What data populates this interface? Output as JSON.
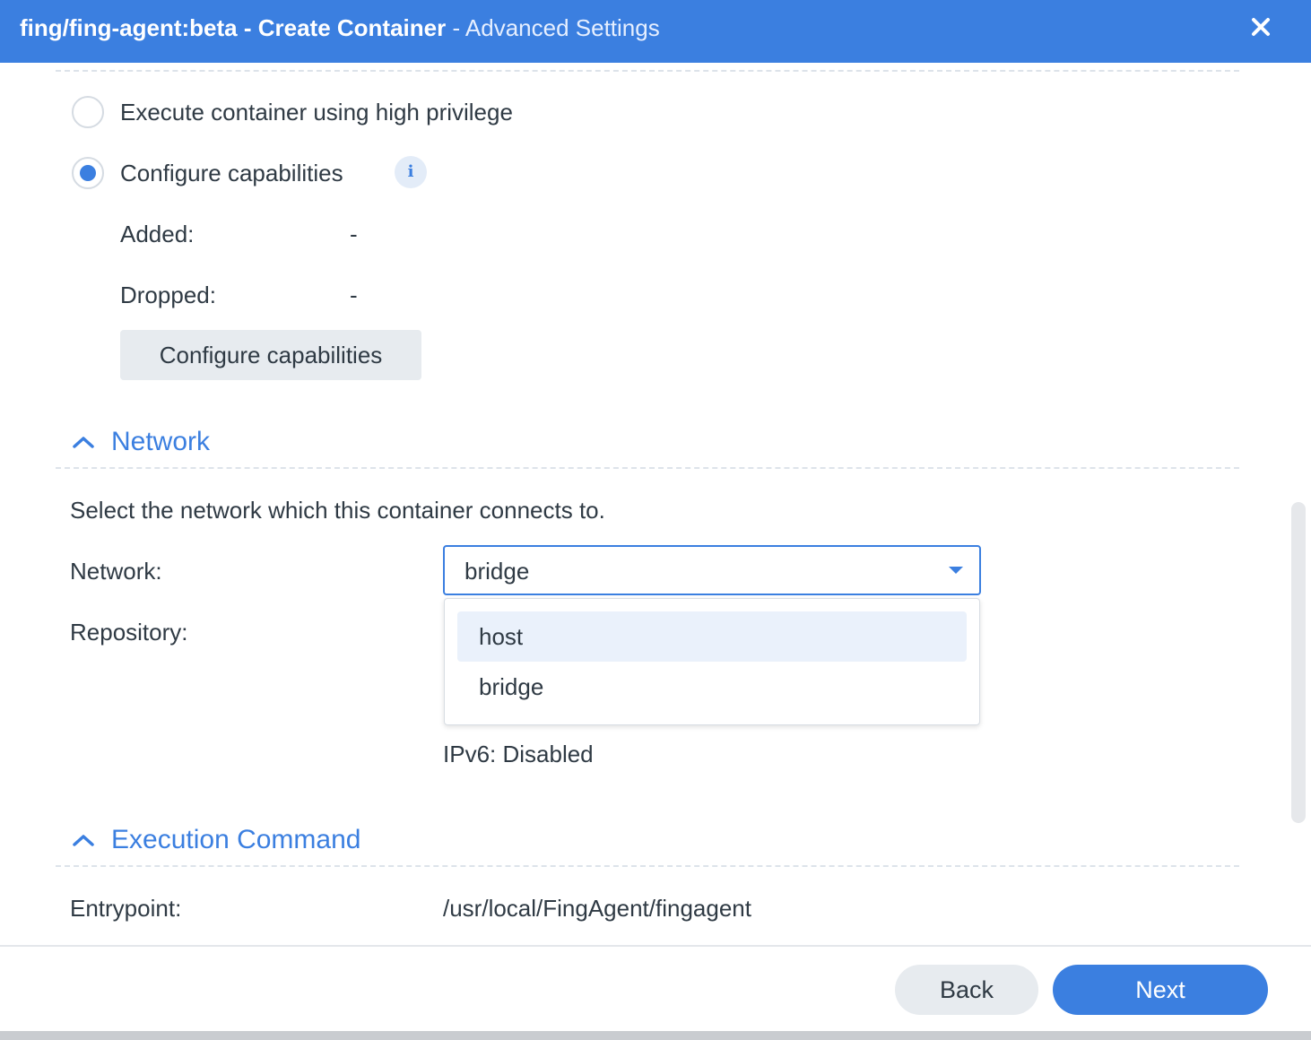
{
  "window": {
    "title_bold": "fing/fing-agent:beta - Create Container",
    "title_suffix": " - Advanced Settings",
    "close_icon": "close-icon"
  },
  "privilege": {
    "high_privilege_label": "Execute container using high privilege",
    "configure_capabilities_label": "Configure capabilities",
    "selected": "configure_capabilities",
    "info_icon": "info-icon",
    "info_glyph": "i",
    "added_label": "Added:",
    "added_value": "-",
    "dropped_label": "Dropped:",
    "dropped_value": "-",
    "configure_button": "Configure capabilities"
  },
  "network": {
    "section_title": "Network",
    "description": "Select the network which this container connects to.",
    "network_label": "Network:",
    "network_value": "bridge",
    "repository_label": "Repository:",
    "options": [
      "host",
      "bridge"
    ],
    "highlighted_option": "host",
    "ipv6": "IPv6: Disabled"
  },
  "execution": {
    "section_title": "Execution Command",
    "entrypoint_label": "Entrypoint:",
    "entrypoint_value": "/usr/local/FingAgent/fingagent"
  },
  "footer": {
    "back": "Back",
    "next": "Next"
  },
  "colors": {
    "accent": "#3b7fe0",
    "highlight": "#eaf1fb",
    "button_gray": "#e7ebef"
  }
}
